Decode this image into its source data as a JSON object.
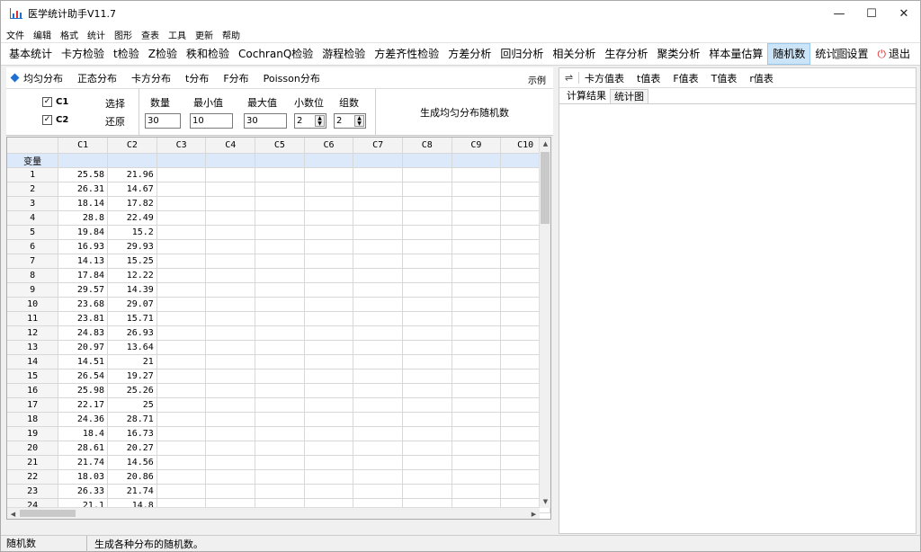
{
  "window": {
    "title": "医学统计助手V11.7",
    "controls": [
      "—",
      "☐",
      "✕"
    ]
  },
  "menu": [
    "文件",
    "编辑",
    "格式",
    "统计",
    "图形",
    "查表",
    "工具",
    "更新",
    "帮助"
  ],
  "toolbar": {
    "items": [
      "基本统计",
      "卡方检验",
      "t检验",
      "Z检验",
      "秩和检验",
      "CochranQ检验",
      "游程检验",
      "方差齐性检验",
      "方差分析",
      "回归分析",
      "相关分析",
      "生存分析",
      "聚类分析",
      "样本量估算",
      "随机数",
      "统计图"
    ],
    "active": "随机数",
    "settings_label": "设置",
    "exit_label": "退出"
  },
  "distributions": {
    "tabs": [
      "均匀分布",
      "正态分布",
      "卡方分布",
      "t分布",
      "F分布",
      "Poisson分布"
    ],
    "active": "均匀分布",
    "sample_label": "示例"
  },
  "params": {
    "c1_label": "C1",
    "c2_label": "C2",
    "c1_checked": true,
    "c2_checked": true,
    "select_label": "选择",
    "reset_label": "还原",
    "count_label": "数量",
    "min_label": "最小值",
    "max_label": "最大值",
    "decimals_label": "小数位",
    "groups_label": "组数",
    "count_value": "30",
    "min_value": "10",
    "max_value": "30",
    "decimals_value": "2",
    "groups_value": "2",
    "generate_label": "生成均匀分布随机数"
  },
  "grid": {
    "columns": [
      "C1",
      "C2",
      "C3",
      "C4",
      "C5",
      "C6",
      "C7",
      "C8",
      "C9",
      "C10"
    ],
    "var_row_label": "变量",
    "rows": [
      [
        "1",
        "25.58",
        "21.96"
      ],
      [
        "2",
        "26.31",
        "14.67"
      ],
      [
        "3",
        "18.14",
        "17.82"
      ],
      [
        "4",
        "28.8",
        "22.49"
      ],
      [
        "5",
        "19.84",
        "15.2"
      ],
      [
        "6",
        "16.93",
        "29.93"
      ],
      [
        "7",
        "14.13",
        "15.25"
      ],
      [
        "8",
        "17.84",
        "12.22"
      ],
      [
        "9",
        "29.57",
        "14.39"
      ],
      [
        "10",
        "23.68",
        "29.07"
      ],
      [
        "11",
        "23.81",
        "15.71"
      ],
      [
        "12",
        "24.83",
        "26.93"
      ],
      [
        "13",
        "20.97",
        "13.64"
      ],
      [
        "14",
        "14.51",
        "21"
      ],
      [
        "15",
        "26.54",
        "19.27"
      ],
      [
        "16",
        "25.98",
        "25.26"
      ],
      [
        "17",
        "22.17",
        "25"
      ],
      [
        "18",
        "24.36",
        "28.71"
      ],
      [
        "19",
        "18.4",
        "16.73"
      ],
      [
        "20",
        "28.61",
        "20.27"
      ],
      [
        "21",
        "21.74",
        "14.56"
      ],
      [
        "22",
        "18.03",
        "20.86"
      ],
      [
        "23",
        "26.33",
        "21.74"
      ],
      [
        "24",
        "21.1",
        "14.8"
      ]
    ]
  },
  "right_panel": {
    "tables": [
      "卡方值表",
      "t值表",
      "F值表",
      "T值表",
      "r值表"
    ],
    "subtabs": [
      "计算结果",
      "统计图"
    ],
    "active_subtab": "计算结果"
  },
  "status": {
    "left": "随机数",
    "message": "生成各种分布的随机数。"
  }
}
